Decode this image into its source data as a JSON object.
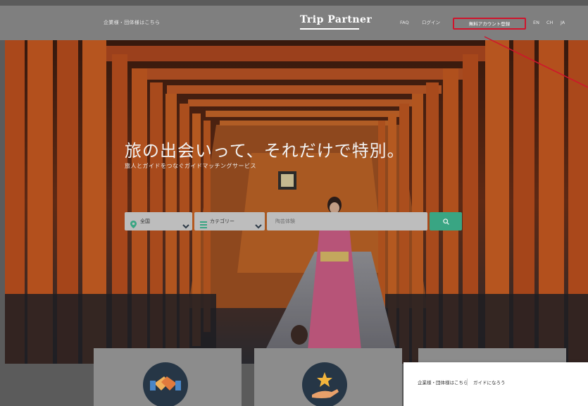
{
  "header": {
    "corp_link": "企業様・団体様はこちら",
    "logo": "Trip Partner",
    "nav": {
      "faq": "FAQ",
      "login": "ログイン",
      "signup": "無料アカウント登録",
      "en": "EN",
      "ch": "CH",
      "ja": "JA"
    }
  },
  "hero": {
    "headline": "旅の出会いって、それだけで特別。",
    "subline": "旅人とガイドをつなぐガイドマッチングサービス"
  },
  "search": {
    "area": "全国",
    "category": "カテゴリー",
    "keyword_placeholder": "陶芸体験",
    "search_icon": "search-icon"
  },
  "popup": {
    "corp_link": "企業様・団体様はこちら",
    "guide_link": "ガイドになろう"
  },
  "colors": {
    "accent_green": "#39a583",
    "highlight_red": "#d0142c",
    "card_circle": "#263646"
  }
}
